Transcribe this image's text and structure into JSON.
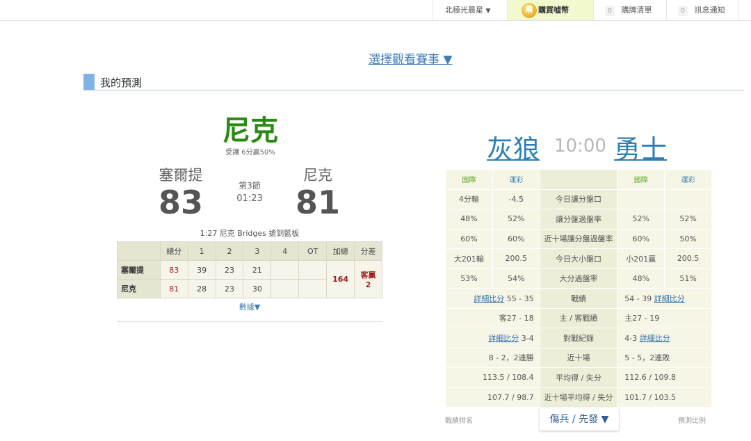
{
  "topbar": {
    "user_name": "北極光晨星",
    "user_caret": "▼",
    "coin_label": "購",
    "buy_label": "購買噓幣",
    "cart_count": "0",
    "cart_label": "購牌清單",
    "msg_count": "0",
    "msg_label": "訊息通知"
  },
  "select_game": "選擇觀看賽事 ▼",
  "section_title": "我的預測",
  "prediction": {
    "team": "尼克",
    "note": "受讓 6分贏50%"
  },
  "game": {
    "away_name": "塞爾提",
    "away_score": "83",
    "home_name": "尼克",
    "home_score": "81",
    "period": "第3節",
    "clock": "01:23",
    "play": "1:27 尼克 Bridges 搶到籃板"
  },
  "boxscore": {
    "headers": [
      "",
      "總分",
      "1",
      "2",
      "3",
      "4",
      "OT",
      "加總",
      "分差"
    ],
    "rows": [
      {
        "team": "塞爾提",
        "total": "83",
        "q1": "39",
        "q2": "23",
        "q3": "21",
        "q4": "",
        "ot": ""
      },
      {
        "team": "尼克",
        "total": "81",
        "q1": "28",
        "q2": "23",
        "q3": "30",
        "q4": "",
        "ot": ""
      }
    ],
    "sum": "164",
    "diff_label": "客贏",
    "diff_value": "2"
  },
  "data_link": "數據▼",
  "matchup": {
    "away": "灰狼",
    "time": "10:00",
    "home": "勇士"
  },
  "stats": {
    "hdr_intl": "國際",
    "hdr_lottery": "運彩",
    "link_label": "詳細比分",
    "rows": {
      "spread": {
        "a1": "4分輸",
        "a2": "-4.5",
        "mid": "今日讓分盤口",
        "h1": "",
        "h2": ""
      },
      "spread_rate": {
        "a1": "48%",
        "a2": "52%",
        "mid": "讓分盤過盤率",
        "h1": "52%",
        "h2": "52%"
      },
      "spread_rate10": {
        "a1": "60%",
        "a2": "60%",
        "mid": "近十場讓分盤過盤率",
        "h1": "60%",
        "h2": "50%"
      },
      "total": {
        "a1": "大201輸",
        "a2": "200.5",
        "mid": "今日大小盤口",
        "h1": "小201贏",
        "h2": "200.5"
      },
      "total_rate": {
        "a1": "53%",
        "a2": "54%",
        "mid": "大分過盤率",
        "h1": "48%",
        "h2": "51%"
      },
      "record": {
        "a": "55 - 35",
        "mid": "戰績",
        "h": "54 - 39"
      },
      "home_away": {
        "a": "客27 - 18",
        "mid": "主 / 客戰績",
        "h": "主27 - 19"
      },
      "h2h": {
        "a": "3-4",
        "mid": "對戰紀錄",
        "h": "4-3"
      },
      "last10": {
        "a": "8 - 2，2連勝",
        "mid": "近十場",
        "h": "5 - 5，2連敗"
      },
      "avg": {
        "a": "113.5 / 108.4",
        "mid": "平均得 / 失分",
        "h": "112.6 / 109.8"
      },
      "avg10": {
        "a": "107.7 / 98.7",
        "mid": "近十場平均得 / 失分",
        "h": "101.7 / 103.5"
      }
    }
  },
  "footer": {
    "left": "戰績排名",
    "button": "傷兵 / 先發 ▼",
    "right": "預測比例"
  }
}
